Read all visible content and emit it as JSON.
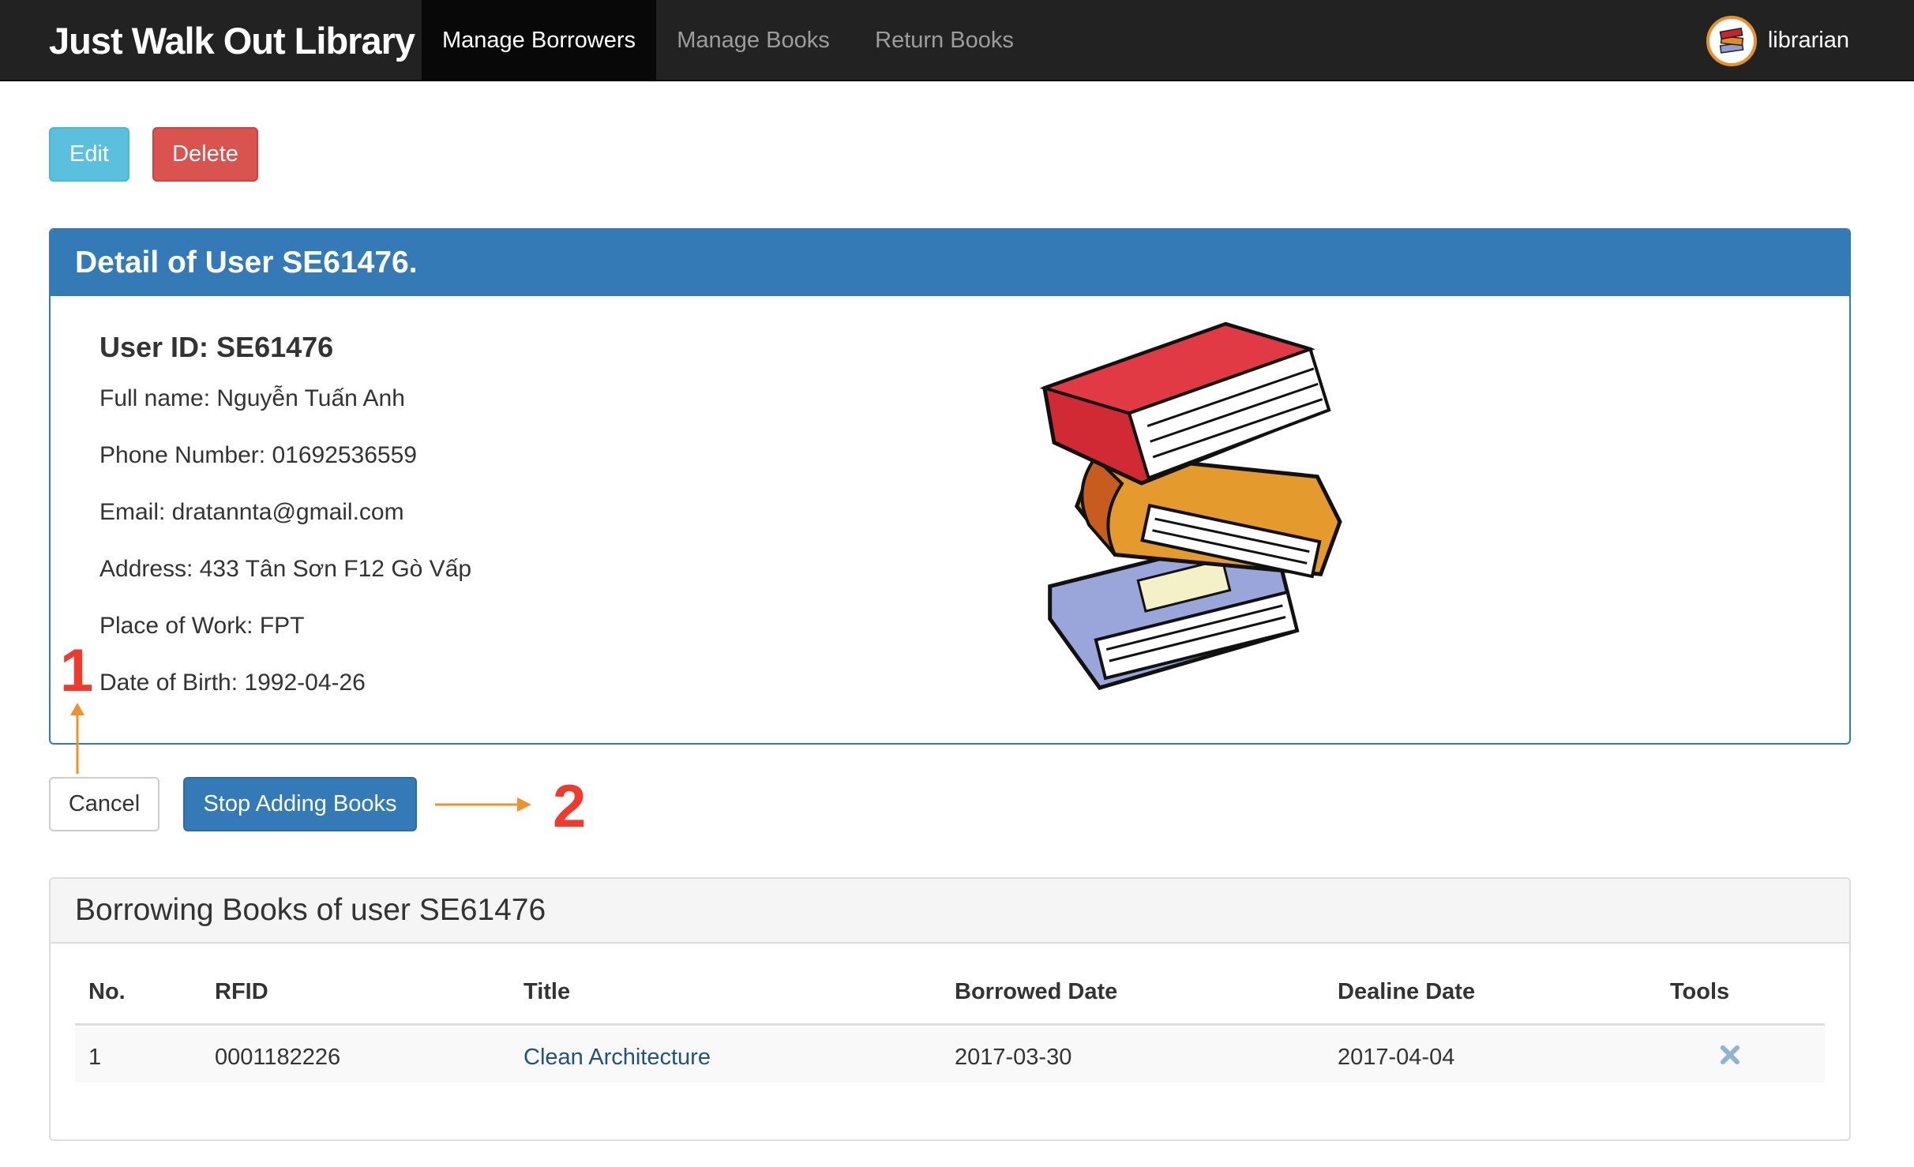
{
  "navbar": {
    "brand": "Just Walk Out Library",
    "items": [
      {
        "label": "Manage Borrowers",
        "active": true
      },
      {
        "label": "Manage Books",
        "active": false
      },
      {
        "label": "Return Books",
        "active": false
      }
    ],
    "user": {
      "name": "librarian",
      "avatar_icon": "books-stack-icon"
    }
  },
  "actions": {
    "edit_label": "Edit",
    "delete_label": "Delete"
  },
  "detail_panel": {
    "title": "Detail of User SE61476.",
    "user_id": "User ID: SE61476",
    "fields": [
      "Full name: Nguyễn Tuấn Anh",
      "Phone Number: 01692536559",
      "Email: dratannta@gmail.com",
      "Address: 433 Tân Sơn F12 Gò Vấp",
      "Place of Work: FPT",
      "Date of Birth: 1992-04-26"
    ],
    "image_icon": "books-stack-illustration"
  },
  "form_buttons": {
    "cancel_label": "Cancel",
    "stop_label": "Stop Adding Books"
  },
  "annotations": {
    "one": "1",
    "two": "2",
    "arrow_color": "#f0922b",
    "number_color": "#f03a2e"
  },
  "borrowing_panel": {
    "title": "Borrowing Books of user SE61476",
    "columns": [
      "No.",
      "RFID",
      "Title",
      "Borrowed Date",
      "Dealine Date",
      "Tools"
    ],
    "rows": [
      {
        "no": "1",
        "rfid": "0001182226",
        "title": "Clean Architecture",
        "borrowed": "2017-03-30",
        "deadline": "2017-04-04",
        "tool_icon": "remove-icon"
      }
    ]
  },
  "colors": {
    "primary": "#337ab7",
    "info": "#5bc0de",
    "danger": "#d9534f",
    "navbar": "#222222"
  }
}
